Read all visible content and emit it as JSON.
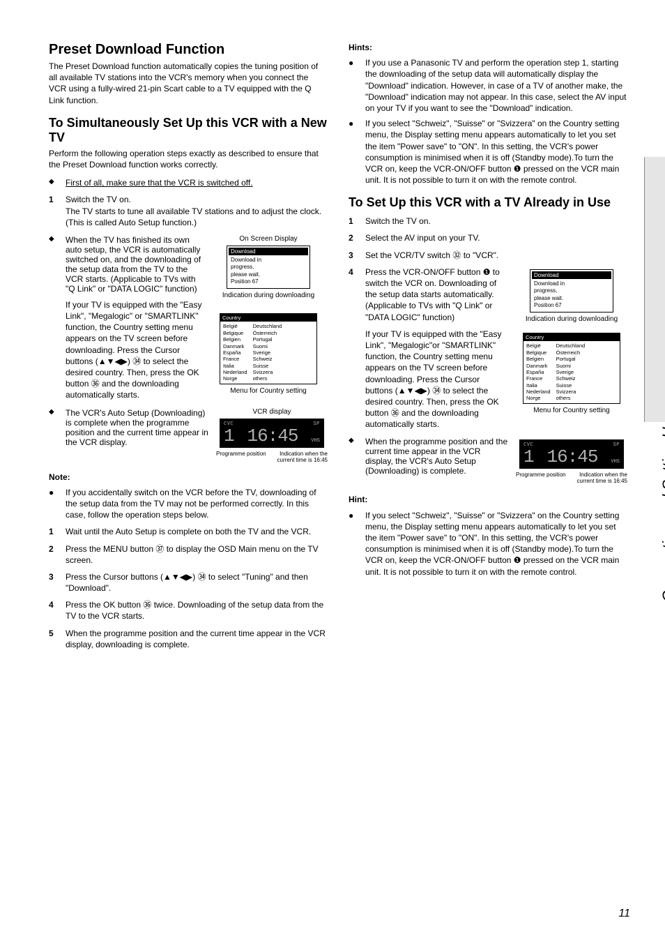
{
  "sideTab": "Connecting and Setting Up",
  "pageNum": "11",
  "left": {
    "h1": "Preset Download Function",
    "intro": "The Preset Download function automatically copies the tuning position of all available TV stations into the VCR's memory when you connect the VCR using a fully-wired 21-pin Scart cable to a TV equipped with the Q Link function.",
    "h2a": "To Simultaneously Set Up this VCR with a New TV",
    "p2": "Perform the following operation steps exactly as described to ensure that the Preset Download function works correctly.",
    "d1": "First of all, make sure that the VCR is switched off.",
    "s1n": "1",
    "s1": "Switch the TV on.",
    "s1b": "The TV starts to tune all available TV stations and to adjust the clock.",
    "s1c": "(This is called Auto Setup function.)",
    "d2a": "When the TV has finished its own auto setup, the VCR is automatically switched on, and the downloading of the setup data from the TV to the VCR starts. (Applicable to TVs with \"Q Link\" or \"DATA LOGIC\" function)",
    "d2b": "If your TV is equipped with the \"Easy Link\", \"Megalogic\" or \"SMARTLINK\" function, the Country setting menu appears on the TV screen before downloading. Press the Cursor buttons (▲▼◀▶) ㉞ to select the desired country. Then, press the OK button ㊱ and the downloading automatically starts.",
    "d3": "The VCR's Auto Setup (Downloading) is complete when the programme position and the current time appear in the VCR display.",
    "osdCap": "On Screen Display",
    "dl": {
      "title": "Download",
      "l1": "Download in",
      "l2": "progress,",
      "l3": "please wait.",
      "l4": "Position   67"
    },
    "dlCap": "Indication during downloading",
    "country": {
      "title": "Country",
      "left": "België\nBelgique\nBelgien\nDanmark\nEspaña\nFrance\nItalia\nNederland\nNorge",
      "right": "Deutschland\nÖsterreich\nPortugal\nSuomi\nSverige\nSchweiz\nSuisse\nSvizzera\nothers"
    },
    "countryCap": "Menu for Country setting",
    "vcrCap": "VCR display",
    "lcd": {
      "cvc": "CVC",
      "sp": "SP",
      "pos": "1",
      "time": "16:45",
      "vhs": "VHS"
    },
    "progLabel": "Programme position",
    "timeLabel": "Indication when the current time is 16:45",
    "noteH": "Note:",
    "noteB": "If you accidentally switch on the VCR before the TV, downloading of the setup data from the TV may not be performed correctly. In this case, follow the operation steps below.",
    "ns1n": "1",
    "ns1": "Wait until the Auto Setup is complete on both the TV and the VCR.",
    "ns2n": "2",
    "ns2": "Press the MENU button ㊲ to display the OSD Main menu on the TV screen.",
    "ns3n": "3",
    "ns3": "Press the Cursor buttons (▲▼◀▶) ㉞ to select \"Tuning\" and then \"Download\".",
    "ns4n": "4",
    "ns4": "Press the OK button ㊱ twice. Downloading of the setup data from the TV to the VCR starts.",
    "ns5n": "5",
    "ns5": "When the programme position and the current time appear in the VCR display, downloading is complete."
  },
  "right": {
    "hintsH": "Hints:",
    "h1": "If you use a Panasonic TV and perform the operation step 1, starting the downloading of the setup data will automatically display the \"Download\" indication. However, in case of a TV of another make, the \"Download\" indication may not appear. In this case, select the AV input on your TV if you want to see the \"Download\" indication.",
    "h2": "If you select \"Schweiz\", \"Suisse\" or \"Svizzera\" on the Country setting menu, the Display setting menu appears automatically to let you set the item \"Power save\" to \"ON\". In this setting, the VCR's power consumption is minimised when it is off (Standby mode).To turn the VCR on, keep the VCR-ON/OFF button ❶ pressed on the VCR main unit. It is not possible to turn it on with the remote control.",
    "h2b": "To Set Up this VCR with a TV Already in Use",
    "s1n": "1",
    "s1": "Switch the TV on.",
    "s2n": "2",
    "s2": "Select the AV input on your TV.",
    "s3n": "3",
    "s3": "Set the VCR/TV switch ㉜ to \"VCR\".",
    "s4n": "4",
    "s4": "Press the VCR-ON/OFF button ❶ to switch the VCR on. Downloading of the setup data starts automatically. (Applicable to TVs with \"Q Link\" or \"DATA LOGIC\" function)",
    "s4b": "If your TV is equipped with the \"Easy Link\", \"Megalogic\"or \"SMARTLINK\" function, the Country setting menu appears on the TV screen before downloading. Press the Cursor buttons (▲▼◀▶) ㉞ to select the desired country. Then, press the OK button ㊱ and the downloading automatically starts.",
    "d1": "When the programme position and the current time appear in the VCR display, the VCR's Auto Setup (Downloading) is complete.",
    "dlCap": "Indication during downloading",
    "countryCap": "Menu for Country setting",
    "progLabel": "Programme position",
    "timeLabel": "Indication when the current time is 16:45",
    "hintH": "Hint:",
    "hint": "If you select \"Schweiz\", \"Suisse\" or \"Svizzera\" on the Country setting menu, the Display setting menu appears automatically to let you set the item \"Power save\" to \"ON\". In this setting, the VCR's power consumption is minimised when it is off (Standby mode).To turn the VCR on, keep the VCR-ON/OFF button ❶ pressed on the VCR main unit. It is not possible to turn it on with the remote control."
  }
}
